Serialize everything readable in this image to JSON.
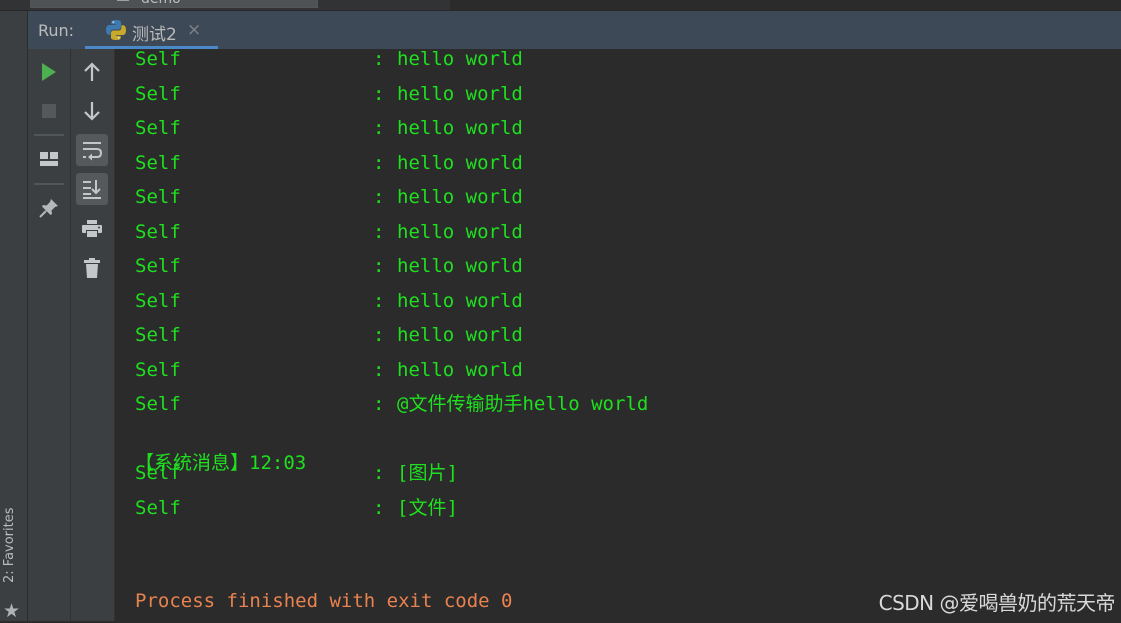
{
  "top_tab": {
    "label": "demo",
    "icon": "document-icon"
  },
  "run_panel": {
    "label": "Run:",
    "tab": {
      "title": "测试2",
      "icon": "python-icon",
      "close": "×"
    }
  },
  "toolbar_left": [
    {
      "name": "run-icon",
      "tooltip": "Rerun"
    },
    {
      "name": "stop-icon",
      "tooltip": "Stop"
    },
    {
      "name": "layout-icon",
      "tooltip": "Restore layout"
    },
    {
      "name": "pin-icon",
      "tooltip": "Pin tab"
    }
  ],
  "toolbar_right": [
    {
      "name": "arrow-up-icon",
      "tooltip": "Up the stack trace"
    },
    {
      "name": "arrow-down-icon",
      "tooltip": "Down the stack trace"
    },
    {
      "name": "soft-wrap-icon",
      "tooltip": "Soft-wrap",
      "active": true
    },
    {
      "name": "scroll-to-end-icon",
      "tooltip": "Scroll to end",
      "active": true
    },
    {
      "name": "print-icon",
      "tooltip": "Print"
    },
    {
      "name": "trash-icon",
      "tooltip": "Clear all"
    }
  ],
  "favorites": {
    "label": "2: Favorites"
  },
  "console": {
    "lines": [
      {
        "sender": "Self",
        "colon": ":",
        "msg": "hello world"
      },
      {
        "sender": "Self",
        "colon": ":",
        "msg": "hello world"
      },
      {
        "sender": "Self",
        "colon": ":",
        "msg": "hello world"
      },
      {
        "sender": "Self",
        "colon": ":",
        "msg": "hello world"
      },
      {
        "sender": "Self",
        "colon": ":",
        "msg": "hello world"
      },
      {
        "sender": "Self",
        "colon": ":",
        "msg": "hello world"
      },
      {
        "sender": "Self",
        "colon": ":",
        "msg": "hello world"
      },
      {
        "sender": "Self",
        "colon": ":",
        "msg": "hello world"
      },
      {
        "sender": "Self",
        "colon": ":",
        "msg": "hello world"
      },
      {
        "sender": "Self",
        "colon": ":",
        "msg": "hello world"
      },
      {
        "sender": "Self",
        "colon": ":",
        "msg": "@文件传输助手hello world"
      }
    ],
    "system_message": "【系统消息】12:03",
    "lines_after": [
      {
        "sender": "Self",
        "colon": ":",
        "msg": "[图片]"
      },
      {
        "sender": "Self",
        "colon": ":",
        "msg": "[文件]"
      }
    ],
    "process_line": "Process finished with exit code 0"
  },
  "watermark": "CSDN @爱喝兽奶的荒天帝",
  "colors": {
    "output_green": "#1fe01f",
    "process_orange": "#e9824f",
    "tab_underline": "#4a88c7",
    "run_green": "#4caf50"
  }
}
